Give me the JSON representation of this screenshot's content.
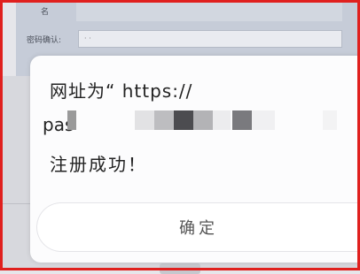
{
  "background_form": {
    "label_top": "名",
    "label_confirm": "密码确认:",
    "confirm_value": "· ·"
  },
  "dialog": {
    "message_line1": "网址为“ https://",
    "message_line2_prefix": "pas",
    "success_text": "注册成功！",
    "ok_label": "确定"
  },
  "colors": {
    "frame_border": "#e0201e",
    "dialog_bg": "#fcfcfd"
  }
}
